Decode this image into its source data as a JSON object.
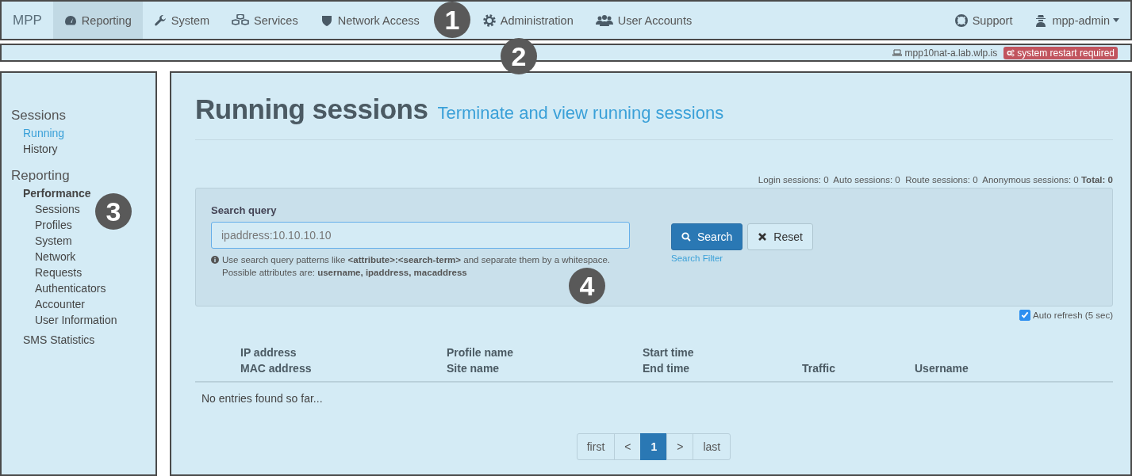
{
  "navbar": {
    "brand": "MPP",
    "items": [
      {
        "label": "Reporting",
        "selected": true
      },
      {
        "label": "System",
        "selected": false
      },
      {
        "label": "Services",
        "selected": false
      },
      {
        "label": "Network Access",
        "selected": false
      },
      {
        "label": "Administration",
        "selected": false
      },
      {
        "label": "User Accounts",
        "selected": false
      }
    ],
    "right_items": [
      {
        "label": "Support",
        "kind": "link"
      },
      {
        "label": "mpp-admin",
        "kind": "dropdown"
      }
    ]
  },
  "status_bar": {
    "host": "mpp10nat-a.lab.wlp.is",
    "alert": "system restart required"
  },
  "sidebar": {
    "sections": [
      {
        "title": "Sessions",
        "items": [
          {
            "label": "Running",
            "selected": true
          },
          {
            "label": "History",
            "selected": false
          }
        ]
      },
      {
        "title": "Reporting",
        "items": [
          {
            "label": "Performance",
            "selected": false,
            "kind": "group",
            "children": [
              {
                "label": "Sessions",
                "selected": false
              },
              {
                "label": "Profiles",
                "selected": false
              },
              {
                "label": "System",
                "selected": false
              },
              {
                "label": "Network",
                "selected": false
              },
              {
                "label": "Requests",
                "selected": false
              },
              {
                "label": "Authenticators",
                "selected": false
              },
              {
                "label": "Accounter",
                "selected": false
              },
              {
                "label": "User Information",
                "selected": false
              }
            ]
          },
          {
            "label": "SMS Statistics",
            "selected": false,
            "kind": "link"
          }
        ]
      }
    ]
  },
  "page": {
    "title": "Running sessions",
    "subtitle": "Terminate and view running sessions",
    "counts": "Login sessions: 0  Auto sessions: 0  Route sessions: 0  Anonymous sessions: 0 **Total: 0**",
    "search": {
      "label": "Search query",
      "placeholder": "ipaddress:10.10.10.10",
      "hint": [
        "Use search query patterns like **<attribute>:<search-term>** and separate them by a whitespace.",
        "Possible attributes are: **username, ipaddress, macaddress**"
      ],
      "search_button": "Search",
      "reset_button": "Reset",
      "filter_link": "Search Filter"
    },
    "auto_refresh": {
      "label": "Auto refresh (5 sec)",
      "checked": true
    },
    "table": {
      "columns": [
        {
          "top": "IP address",
          "bottom": "MAC address"
        },
        {
          "top": "Profile name",
          "bottom": "Site name"
        },
        {
          "top": "Start time",
          "bottom": "End time"
        },
        {
          "bottom": "Traffic"
        },
        {
          "bottom": "Username"
        }
      ],
      "empty_message": "No entries found so far..."
    },
    "pagination": [
      {
        "label": "first",
        "selected": false
      },
      {
        "label": "<",
        "selected": false
      },
      {
        "label": "1",
        "selected": true
      },
      {
        "label": ">",
        "selected": false
      },
      {
        "label": "last",
        "selected": false
      }
    ]
  },
  "callouts": [
    {
      "number": "1"
    },
    {
      "number": "2"
    },
    {
      "number": "3"
    },
    {
      "number": "4"
    }
  ]
}
